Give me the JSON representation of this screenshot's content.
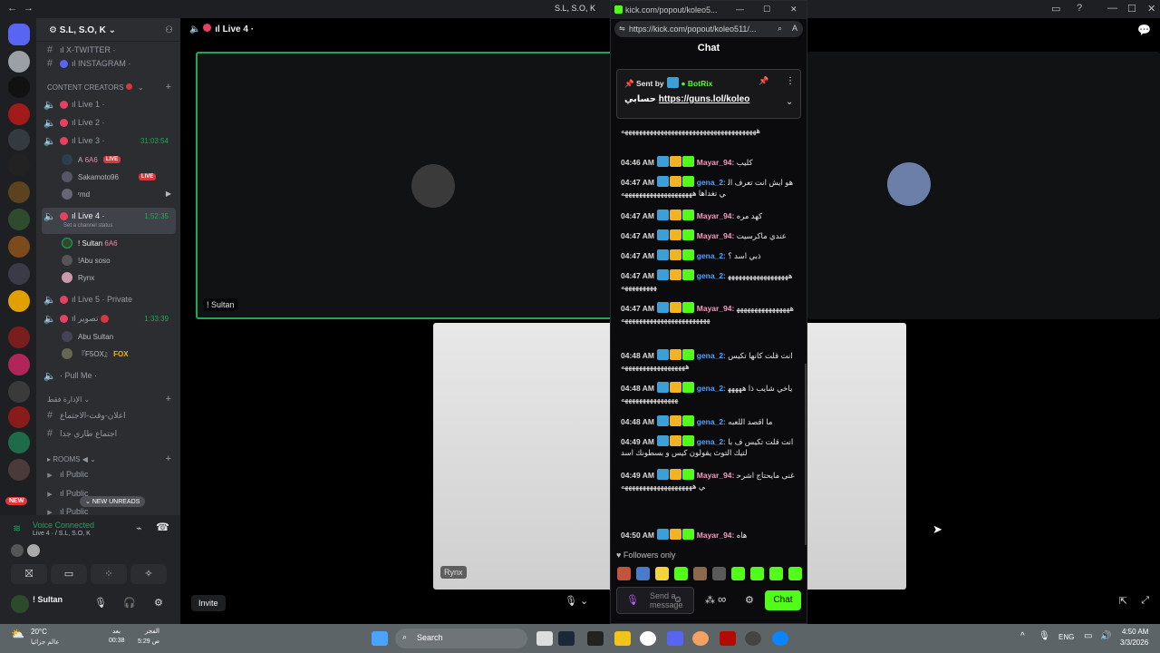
{
  "topbar": {
    "title": "S.L, S.O, K",
    "nav_back": "←",
    "nav_fwd": "→",
    "minimize": "—",
    "maximize": "☐",
    "close": "✕"
  },
  "server": {
    "name": "S.L, S.O, K"
  },
  "channels": {
    "x_twitter": "ıl X-TWITTER ·",
    "instagram": "ıl INSTAGRAM ·",
    "category_creators": "CONTENT CREATORS",
    "live1": "ıl Live 1 ·",
    "live2": "ıl Live 2 ·",
    "live3": "ıl Live 3 ·",
    "live3_timer": "31:03:54",
    "live3_users": [
      {
        "name": "A",
        "tag": "6A6",
        "live": "LIVE"
      },
      {
        "name": "Sakamoto96",
        "live": "LIVE"
      },
      {
        "name": "ʳmd"
      }
    ],
    "live4": "ıl Live 4 ·",
    "live4_timer": "1:52:35",
    "live4_status": "Set a channel status",
    "live4_users": [
      {
        "name": "! Sultan",
        "tag": "6A6"
      },
      {
        "name": "!Abu soso"
      },
      {
        "name": "Rynx"
      }
    ],
    "live5": "ıl Live 5 · Private",
    "ch_arabic": "ıl تصوير",
    "ch_arabic_timer": "1:33:39",
    "arabic_users": [
      {
        "name": "Abu Sultan"
      },
      {
        "name": "『F5OX』",
        "tag": "FOX"
      }
    ],
    "pullme": "· Pull Me ·",
    "category_admin": "الإدارة فقط",
    "admin1": "اعلان-وقت-الاجتماع",
    "admin2": "اجتماع طاري جدا",
    "category_rooms": "ROOMS",
    "public1": "ıl Public",
    "public2": "ıl Public",
    "public3": "ıl Public",
    "new_unreads": "NEW UNREADS"
  },
  "voice": {
    "status": "Voice Connected",
    "sub": "Live 4 · / S.L, S.O, K",
    "user": "! Sultan"
  },
  "stage": {
    "header": "ıl Live 4 ·",
    "tile1_name": "! Sultan",
    "tile2_name": "Rynx",
    "invite": "Invite"
  },
  "chat": {
    "tab_title": "kick.com/popout/koleo5...",
    "url": "https://kick.com/popout/koleo511/...",
    "heading": "Chat",
    "pinned_by": "Sent by",
    "pinned_bot": "BotRix",
    "pinned_text": "حسابي",
    "pinned_link": "https://guns.lol/koleo",
    "messages": [
      {
        "time": "",
        "user": "",
        "text": "ههههههههههههههههههههههههههههههههههههههه",
        "cls": "u1"
      },
      {
        "time": "04:46 AM",
        "user": "Mayar_94:",
        "text": "كليب",
        "cls": "u1"
      },
      {
        "time": "04:47 AM",
        "user": "gena_2:",
        "text": "هو ايش انت تعرف الي تغداها ههههههههههههههههههههه",
        "cls": "u2"
      },
      {
        "time": "04:47 AM",
        "user": "Mayar_94:",
        "text": "كهد مره",
        "cls": "u1"
      },
      {
        "time": "04:47 AM",
        "user": "Mayar_94:",
        "text": "عندي ماكرسيت",
        "cls": "u1"
      },
      {
        "time": "04:47 AM",
        "user": "gena_2:",
        "text": "ذبي اسد ؟",
        "cls": "u2"
      },
      {
        "time": "04:47 AM",
        "user": "gena_2:",
        "text": "هههههههههههههههههههههههههههه",
        "cls": "u2"
      },
      {
        "time": "04:47 AM",
        "user": "Mayar_94:",
        "text": "ههههههههههههههههههههههههههههههههههههههههه",
        "cls": "u1"
      },
      {
        "time": "04:48 AM",
        "user": "gena_2:",
        "text": "انت قلت كانها تكيس ههههههههههههههههههه",
        "cls": "u2"
      },
      {
        "time": "04:48 AM",
        "user": "gena_2:",
        "text": "ياخي شايب ذا ههههههههههههههههههههه",
        "cls": "u2"
      },
      {
        "time": "04:48 AM",
        "user": "gena_2:",
        "text": "ما اقصد اللعبه",
        "cls": "u2"
      },
      {
        "time": "04:49 AM",
        "user": "gena_2:",
        "text": "انت قلت تكيس ف بالتيك التوث يقولون كيس و بسطونك اسد",
        "cls": "u2"
      },
      {
        "time": "04:49 AM",
        "user": "Mayar_94:",
        "text": "غنى مايحتاج اشرحي ههههههههههههههههههههه",
        "cls": "u1"
      },
      {
        "time": "04:50 AM",
        "user": "Mayar_94:",
        "text": "هاه",
        "cls": "u1"
      }
    ],
    "followers_only": "Followers only",
    "send_placeholder": "Send a message",
    "chat_button": "Chat"
  },
  "taskbar": {
    "weather_temp": "20°C",
    "weather_desc": "عالم جزائيا",
    "prayer1_name": "بعد",
    "prayer1_time": "00:38",
    "prayer2_name": "الفجر",
    "prayer2_time": "5:29 ص",
    "search": "Search",
    "lang": "ENG",
    "time": "4:50 AM",
    "date": "3/3/2026"
  }
}
